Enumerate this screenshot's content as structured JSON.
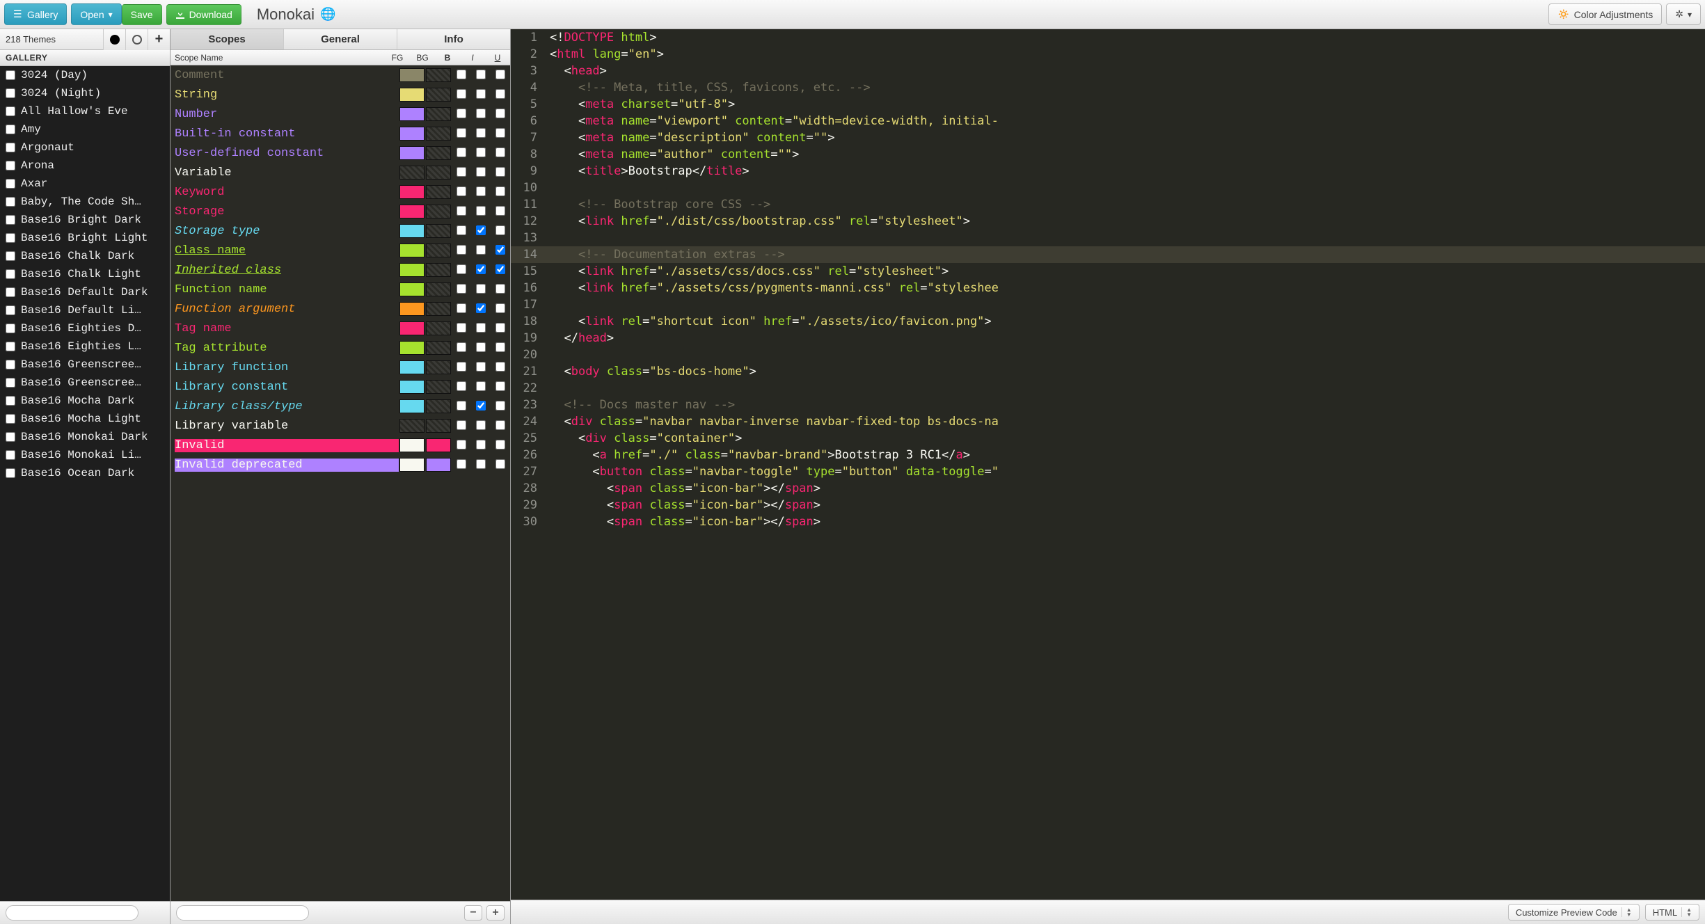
{
  "toolbar": {
    "gallery": "Gallery",
    "open": "Open",
    "save": "Save",
    "download": "Download",
    "color_adjustments": "Color Adjustments"
  },
  "theme_name": "Monokai",
  "left": {
    "count_label": "218 Themes",
    "gallery_header": "GALLERY",
    "themes": [
      "3024 (Day)",
      "3024 (Night)",
      "All Hallow's Eve",
      "Amy",
      "Argonaut",
      "Arona",
      "Axar",
      "Baby, The Code Sh…",
      "Base16 Bright Dark",
      "Base16 Bright Light",
      "Base16 Chalk Dark",
      "Base16 Chalk Light",
      "Base16 Default Dark",
      "Base16 Default Li…",
      "Base16 Eighties D…",
      "Base16 Eighties L…",
      "Base16 Greenscree…",
      "Base16 Greenscree…",
      "Base16 Mocha Dark",
      "Base16 Mocha Light",
      "Base16 Monokai Dark",
      "Base16 Monokai Li…",
      "Base16 Ocean Dark"
    ]
  },
  "tabs": {
    "scopes": "Scopes",
    "general": "General",
    "info": "Info"
  },
  "scope_headers": {
    "name": "Scope Name",
    "fg": "FG",
    "bg": "BG",
    "b": "B",
    "i": "I",
    "u": "U"
  },
  "scopes": [
    {
      "label": "Comment",
      "color": "#75715e",
      "fg": "#8a8668",
      "bg": null,
      "b": false,
      "i": false,
      "u": false
    },
    {
      "label": "String",
      "color": "#e6db74",
      "fg": "#e6db74",
      "bg": null,
      "b": false,
      "i": false,
      "u": false
    },
    {
      "label": "Number",
      "color": "#ae81ff",
      "fg": "#ae81ff",
      "bg": null,
      "b": false,
      "i": false,
      "u": false
    },
    {
      "label": "Built-in constant",
      "color": "#ae81ff",
      "fg": "#ae81ff",
      "bg": null,
      "b": false,
      "i": false,
      "u": false
    },
    {
      "label": "User-defined constant",
      "color": "#ae81ff",
      "fg": "#ae81ff",
      "bg": null,
      "b": false,
      "i": false,
      "u": false
    },
    {
      "label": "Variable",
      "color": "#f8f8f2",
      "fg": null,
      "bg": null,
      "b": false,
      "i": false,
      "u": false
    },
    {
      "label": "Keyword",
      "color": "#f92672",
      "fg": "#f92672",
      "bg": null,
      "b": false,
      "i": false,
      "u": false
    },
    {
      "label": "Storage",
      "color": "#f92672",
      "fg": "#f92672",
      "bg": null,
      "b": false,
      "i": false,
      "u": false
    },
    {
      "label": "Storage type",
      "color": "#66d9ef",
      "fg": "#66d9ef",
      "bg": null,
      "b": false,
      "i": true,
      "u": false,
      "italic": true
    },
    {
      "label": "Class name",
      "color": "#a6e22e",
      "fg": "#a6e22e",
      "bg": null,
      "b": false,
      "i": false,
      "u": true,
      "underline": true
    },
    {
      "label": "Inherited class",
      "color": "#a6e22e",
      "fg": "#a6e22e",
      "bg": null,
      "b": false,
      "i": true,
      "u": true,
      "italic": true,
      "underline": true
    },
    {
      "label": "Function name",
      "color": "#a6e22e",
      "fg": "#a6e22e",
      "bg": null,
      "b": false,
      "i": false,
      "u": false
    },
    {
      "label": "Function argument",
      "color": "#fd971f",
      "fg": "#fd971f",
      "bg": null,
      "b": false,
      "i": true,
      "u": false,
      "italic": true
    },
    {
      "label": "Tag name",
      "color": "#f92672",
      "fg": "#f92672",
      "bg": null,
      "b": false,
      "i": false,
      "u": false
    },
    {
      "label": "Tag attribute",
      "color": "#a6e22e",
      "fg": "#a6e22e",
      "bg": null,
      "b": false,
      "i": false,
      "u": false
    },
    {
      "label": "Library function",
      "color": "#66d9ef",
      "fg": "#66d9ef",
      "bg": null,
      "b": false,
      "i": false,
      "u": false
    },
    {
      "label": "Library constant",
      "color": "#66d9ef",
      "fg": "#66d9ef",
      "bg": null,
      "b": false,
      "i": false,
      "u": false
    },
    {
      "label": "Library class/type",
      "color": "#66d9ef",
      "fg": "#66d9ef",
      "bg": null,
      "b": false,
      "i": true,
      "u": false,
      "italic": true
    },
    {
      "label": "Library variable",
      "color": "#f8f8f2",
      "fg": null,
      "bg": null,
      "b": false,
      "i": false,
      "u": false
    },
    {
      "label": "Invalid",
      "color": "#f8f8f0",
      "fg": "#f8f8f0",
      "bg": "#f92672",
      "b": false,
      "i": false,
      "u": false,
      "row_bg": "#f92672"
    },
    {
      "label": "Invalid deprecated",
      "color": "#f8f8f0",
      "fg": "#f8f8f0",
      "bg": "#ae81ff",
      "b": false,
      "i": false,
      "u": false,
      "row_bg": "#ae81ff"
    }
  ],
  "preview": {
    "active_line": 14,
    "lines": [
      {
        "n": 1,
        "tokens": [
          {
            "t": "<!",
            "c": "punct"
          },
          {
            "t": "DOCTYPE ",
            "c": "doctype"
          },
          {
            "t": "html",
            "c": "attr"
          },
          {
            "t": ">",
            "c": "punct"
          }
        ]
      },
      {
        "n": 2,
        "tokens": [
          {
            "t": "<",
            "c": "punct"
          },
          {
            "t": "html ",
            "c": "tag"
          },
          {
            "t": "lang",
            "c": "attr"
          },
          {
            "t": "=",
            "c": "punct"
          },
          {
            "t": "\"en\"",
            "c": "str"
          },
          {
            "t": ">",
            "c": "punct"
          }
        ]
      },
      {
        "n": 3,
        "tokens": [
          {
            "t": "  <",
            "c": "punct"
          },
          {
            "t": "head",
            "c": "tag"
          },
          {
            "t": ">",
            "c": "punct"
          }
        ]
      },
      {
        "n": 4,
        "tokens": [
          {
            "t": "    ",
            "c": "text"
          },
          {
            "t": "<!-- Meta, title, CSS, favicons, etc. -->",
            "c": "comment"
          }
        ]
      },
      {
        "n": 5,
        "tokens": [
          {
            "t": "    <",
            "c": "punct"
          },
          {
            "t": "meta ",
            "c": "tag"
          },
          {
            "t": "charset",
            "c": "attr"
          },
          {
            "t": "=",
            "c": "punct"
          },
          {
            "t": "\"utf-8\"",
            "c": "str"
          },
          {
            "t": ">",
            "c": "punct"
          }
        ]
      },
      {
        "n": 6,
        "tokens": [
          {
            "t": "    <",
            "c": "punct"
          },
          {
            "t": "meta ",
            "c": "tag"
          },
          {
            "t": "name",
            "c": "attr"
          },
          {
            "t": "=",
            "c": "punct"
          },
          {
            "t": "\"viewport\" ",
            "c": "str"
          },
          {
            "t": "content",
            "c": "attr"
          },
          {
            "t": "=",
            "c": "punct"
          },
          {
            "t": "\"width=device-width, initial-",
            "c": "str"
          }
        ]
      },
      {
        "n": 7,
        "tokens": [
          {
            "t": "    <",
            "c": "punct"
          },
          {
            "t": "meta ",
            "c": "tag"
          },
          {
            "t": "name",
            "c": "attr"
          },
          {
            "t": "=",
            "c": "punct"
          },
          {
            "t": "\"description\" ",
            "c": "str"
          },
          {
            "t": "content",
            "c": "attr"
          },
          {
            "t": "=",
            "c": "punct"
          },
          {
            "t": "\"\"",
            "c": "str"
          },
          {
            "t": ">",
            "c": "punct"
          }
        ]
      },
      {
        "n": 8,
        "tokens": [
          {
            "t": "    <",
            "c": "punct"
          },
          {
            "t": "meta ",
            "c": "tag"
          },
          {
            "t": "name",
            "c": "attr"
          },
          {
            "t": "=",
            "c": "punct"
          },
          {
            "t": "\"author\" ",
            "c": "str"
          },
          {
            "t": "content",
            "c": "attr"
          },
          {
            "t": "=",
            "c": "punct"
          },
          {
            "t": "\"\"",
            "c": "str"
          },
          {
            "t": ">",
            "c": "punct"
          }
        ]
      },
      {
        "n": 9,
        "tokens": [
          {
            "t": "    <",
            "c": "punct"
          },
          {
            "t": "title",
            "c": "tag"
          },
          {
            "t": ">",
            "c": "punct"
          },
          {
            "t": "Bootstrap",
            "c": "text"
          },
          {
            "t": "</",
            "c": "punct"
          },
          {
            "t": "title",
            "c": "tag"
          },
          {
            "t": ">",
            "c": "punct"
          }
        ]
      },
      {
        "n": 10,
        "tokens": [
          {
            "t": "",
            "c": "text"
          }
        ]
      },
      {
        "n": 11,
        "tokens": [
          {
            "t": "    ",
            "c": "text"
          },
          {
            "t": "<!-- Bootstrap core CSS -->",
            "c": "comment"
          }
        ]
      },
      {
        "n": 12,
        "tokens": [
          {
            "t": "    <",
            "c": "punct"
          },
          {
            "t": "link ",
            "c": "tag"
          },
          {
            "t": "href",
            "c": "attr"
          },
          {
            "t": "=",
            "c": "punct"
          },
          {
            "t": "\"./dist/css/bootstrap.css\" ",
            "c": "str"
          },
          {
            "t": "rel",
            "c": "attr"
          },
          {
            "t": "=",
            "c": "punct"
          },
          {
            "t": "\"stylesheet\"",
            "c": "str"
          },
          {
            "t": ">",
            "c": "punct"
          }
        ]
      },
      {
        "n": 13,
        "tokens": [
          {
            "t": "",
            "c": "text"
          }
        ]
      },
      {
        "n": 14,
        "tokens": [
          {
            "t": "    ",
            "c": "text"
          },
          {
            "t": "<!-- Documentation extras -->",
            "c": "comment"
          }
        ]
      },
      {
        "n": 15,
        "tokens": [
          {
            "t": "    <",
            "c": "punct"
          },
          {
            "t": "link ",
            "c": "tag"
          },
          {
            "t": "href",
            "c": "attr"
          },
          {
            "t": "=",
            "c": "punct"
          },
          {
            "t": "\"./assets/css/docs.css\" ",
            "c": "str"
          },
          {
            "t": "rel",
            "c": "attr"
          },
          {
            "t": "=",
            "c": "punct"
          },
          {
            "t": "\"stylesheet\"",
            "c": "str"
          },
          {
            "t": ">",
            "c": "punct"
          }
        ]
      },
      {
        "n": 16,
        "tokens": [
          {
            "t": "    <",
            "c": "punct"
          },
          {
            "t": "link ",
            "c": "tag"
          },
          {
            "t": "href",
            "c": "attr"
          },
          {
            "t": "=",
            "c": "punct"
          },
          {
            "t": "\"./assets/css/pygments-manni.css\" ",
            "c": "str"
          },
          {
            "t": "rel",
            "c": "attr"
          },
          {
            "t": "=",
            "c": "punct"
          },
          {
            "t": "\"styleshee",
            "c": "str"
          }
        ]
      },
      {
        "n": 17,
        "tokens": [
          {
            "t": "",
            "c": "text"
          }
        ]
      },
      {
        "n": 18,
        "tokens": [
          {
            "t": "    <",
            "c": "punct"
          },
          {
            "t": "link ",
            "c": "tag"
          },
          {
            "t": "rel",
            "c": "attr"
          },
          {
            "t": "=",
            "c": "punct"
          },
          {
            "t": "\"shortcut icon\" ",
            "c": "str"
          },
          {
            "t": "href",
            "c": "attr"
          },
          {
            "t": "=",
            "c": "punct"
          },
          {
            "t": "\"./assets/ico/favicon.png\"",
            "c": "str"
          },
          {
            "t": ">",
            "c": "punct"
          }
        ]
      },
      {
        "n": 19,
        "tokens": [
          {
            "t": "  </",
            "c": "punct"
          },
          {
            "t": "head",
            "c": "tag"
          },
          {
            "t": ">",
            "c": "punct"
          }
        ]
      },
      {
        "n": 20,
        "tokens": [
          {
            "t": "",
            "c": "text"
          }
        ]
      },
      {
        "n": 21,
        "tokens": [
          {
            "t": "  <",
            "c": "punct"
          },
          {
            "t": "body ",
            "c": "tag"
          },
          {
            "t": "class",
            "c": "attr"
          },
          {
            "t": "=",
            "c": "punct"
          },
          {
            "t": "\"bs-docs-home\"",
            "c": "str"
          },
          {
            "t": ">",
            "c": "punct"
          }
        ]
      },
      {
        "n": 22,
        "tokens": [
          {
            "t": "",
            "c": "text"
          }
        ]
      },
      {
        "n": 23,
        "tokens": [
          {
            "t": "  ",
            "c": "text"
          },
          {
            "t": "<!-- Docs master nav -->",
            "c": "comment"
          }
        ]
      },
      {
        "n": 24,
        "tokens": [
          {
            "t": "  <",
            "c": "punct"
          },
          {
            "t": "div ",
            "c": "tag"
          },
          {
            "t": "class",
            "c": "attr"
          },
          {
            "t": "=",
            "c": "punct"
          },
          {
            "t": "\"navbar navbar-inverse navbar-fixed-top bs-docs-na",
            "c": "str"
          }
        ]
      },
      {
        "n": 25,
        "tokens": [
          {
            "t": "    <",
            "c": "punct"
          },
          {
            "t": "div ",
            "c": "tag"
          },
          {
            "t": "class",
            "c": "attr"
          },
          {
            "t": "=",
            "c": "punct"
          },
          {
            "t": "\"container\"",
            "c": "str"
          },
          {
            "t": ">",
            "c": "punct"
          }
        ]
      },
      {
        "n": 26,
        "tokens": [
          {
            "t": "      <",
            "c": "punct"
          },
          {
            "t": "a ",
            "c": "tag"
          },
          {
            "t": "href",
            "c": "attr"
          },
          {
            "t": "=",
            "c": "punct"
          },
          {
            "t": "\"./\" ",
            "c": "str"
          },
          {
            "t": "class",
            "c": "attr"
          },
          {
            "t": "=",
            "c": "punct"
          },
          {
            "t": "\"navbar-brand\"",
            "c": "str"
          },
          {
            "t": ">",
            "c": "punct"
          },
          {
            "t": "Bootstrap 3 RC1",
            "c": "text"
          },
          {
            "t": "</",
            "c": "punct"
          },
          {
            "t": "a",
            "c": "tag"
          },
          {
            "t": ">",
            "c": "punct"
          }
        ]
      },
      {
        "n": 27,
        "tokens": [
          {
            "t": "      <",
            "c": "punct"
          },
          {
            "t": "button ",
            "c": "tag"
          },
          {
            "t": "class",
            "c": "attr"
          },
          {
            "t": "=",
            "c": "punct"
          },
          {
            "t": "\"navbar-toggle\" ",
            "c": "str"
          },
          {
            "t": "type",
            "c": "attr"
          },
          {
            "t": "=",
            "c": "punct"
          },
          {
            "t": "\"button\" ",
            "c": "str"
          },
          {
            "t": "data-toggle",
            "c": "attr"
          },
          {
            "t": "=",
            "c": "punct"
          },
          {
            "t": "\"",
            "c": "str"
          }
        ]
      },
      {
        "n": 28,
        "tokens": [
          {
            "t": "        <",
            "c": "punct"
          },
          {
            "t": "span ",
            "c": "tag"
          },
          {
            "t": "class",
            "c": "attr"
          },
          {
            "t": "=",
            "c": "punct"
          },
          {
            "t": "\"icon-bar\"",
            "c": "str"
          },
          {
            "t": "></",
            "c": "punct"
          },
          {
            "t": "span",
            "c": "tag"
          },
          {
            "t": ">",
            "c": "punct"
          }
        ]
      },
      {
        "n": 29,
        "tokens": [
          {
            "t": "        <",
            "c": "punct"
          },
          {
            "t": "span ",
            "c": "tag"
          },
          {
            "t": "class",
            "c": "attr"
          },
          {
            "t": "=",
            "c": "punct"
          },
          {
            "t": "\"icon-bar\"",
            "c": "str"
          },
          {
            "t": "></",
            "c": "punct"
          },
          {
            "t": "span",
            "c": "tag"
          },
          {
            "t": ">",
            "c": "punct"
          }
        ]
      },
      {
        "n": 30,
        "tokens": [
          {
            "t": "        <",
            "c": "punct"
          },
          {
            "t": "span ",
            "c": "tag"
          },
          {
            "t": "class",
            "c": "attr"
          },
          {
            "t": "=",
            "c": "punct"
          },
          {
            "t": "\"icon-bar\"",
            "c": "str"
          },
          {
            "t": "></",
            "c": "punct"
          },
          {
            "t": "span",
            "c": "tag"
          },
          {
            "t": ">",
            "c": "punct"
          }
        ]
      }
    ]
  },
  "bottom": {
    "customize": "Customize Preview Code",
    "lang": "HTML"
  }
}
